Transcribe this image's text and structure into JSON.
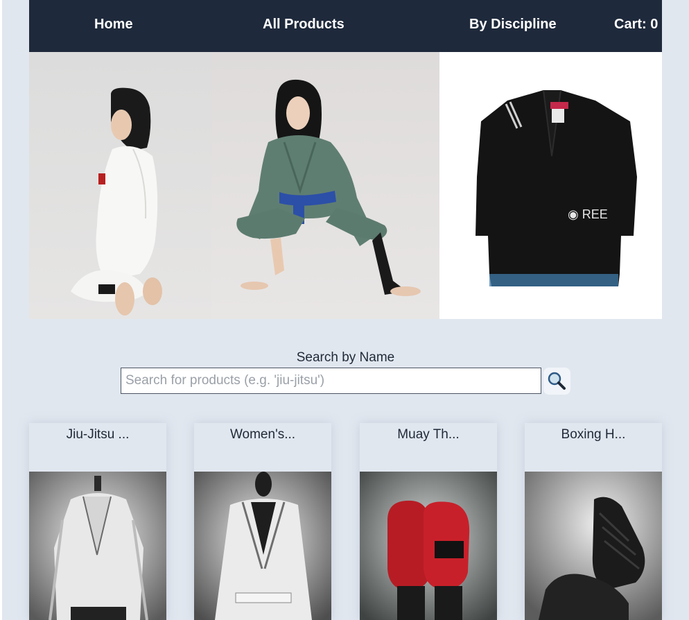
{
  "nav": {
    "home": "Home",
    "all_products": "All Products",
    "by_discipline": "By Discipline",
    "cart": "Cart: 0"
  },
  "hero": {
    "images": [
      "woman-in-white-gi-photo",
      "woman-in-green-gi-photo",
      "black-gi-product-photo"
    ]
  },
  "search": {
    "label": "Search by Name",
    "placeholder": "Search for products (e.g. 'jiu-jitsu')",
    "button_icon": "magnifier-icon"
  },
  "products": [
    {
      "title": "Jiu-Jitsu ...",
      "image": "white-gi-on-mannequin"
    },
    {
      "title": "Women's...",
      "image": "white-gi-on-black-mannequin"
    },
    {
      "title": "Muay Th...",
      "image": "red-boxing-gloves"
    },
    {
      "title": "Boxing H...",
      "image": "black-hand-wraps"
    }
  ],
  "colors": {
    "background": "#e1e7ef",
    "nav_background": "#1e293b",
    "nav_text": "#ffffff",
    "text": "#1f2937"
  }
}
